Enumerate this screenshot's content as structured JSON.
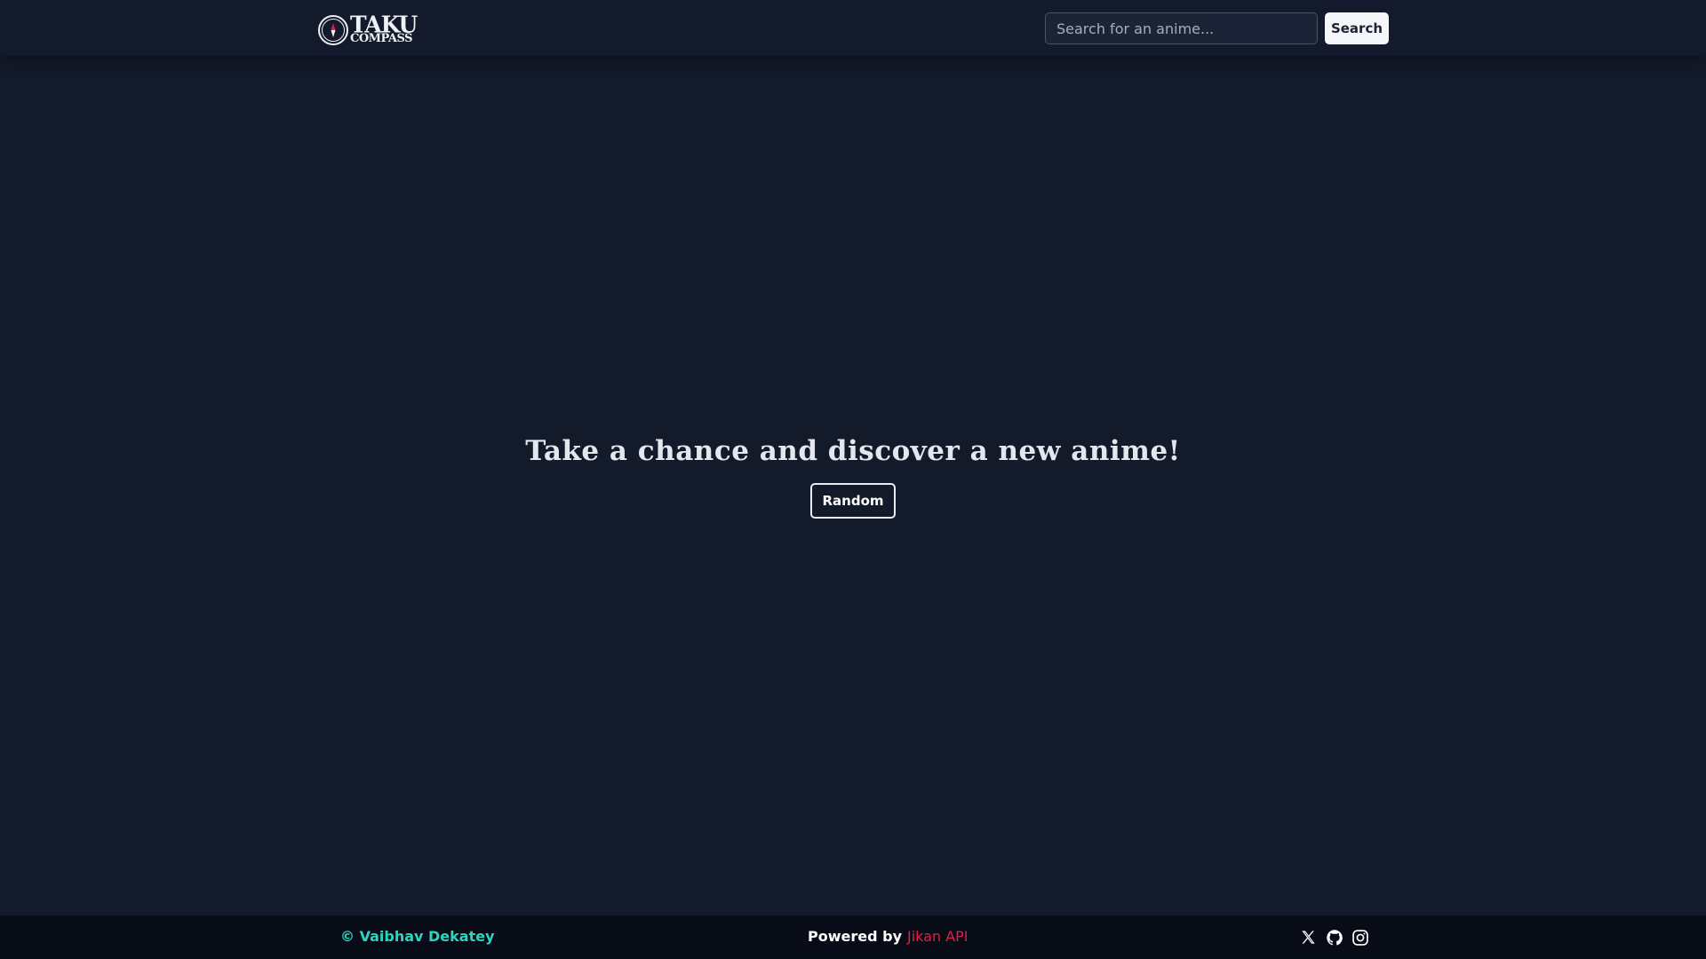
{
  "header": {
    "logo_line1": "TAKU",
    "logo_line2": "COMPASS",
    "search": {
      "placeholder": "Search for an anime...",
      "value": "",
      "button_label": "Search"
    }
  },
  "hero": {
    "title": "Take a chance and discover a new anime!",
    "random_label": "Random"
  },
  "footer": {
    "copyright": "© Vaibhav Dekatey",
    "powered_by_label": "Powered by",
    "api_label": "Jikan API",
    "socials": [
      {
        "icon": "x-twitter-icon"
      },
      {
        "icon": "github-icon"
      },
      {
        "icon": "instagram-icon"
      }
    ]
  },
  "colors": {
    "background": "#131a2a",
    "header": "#121a2b",
    "footer": "#080c17",
    "accent_teal": "#2dd4bf",
    "accent_red": "#e11d48"
  }
}
